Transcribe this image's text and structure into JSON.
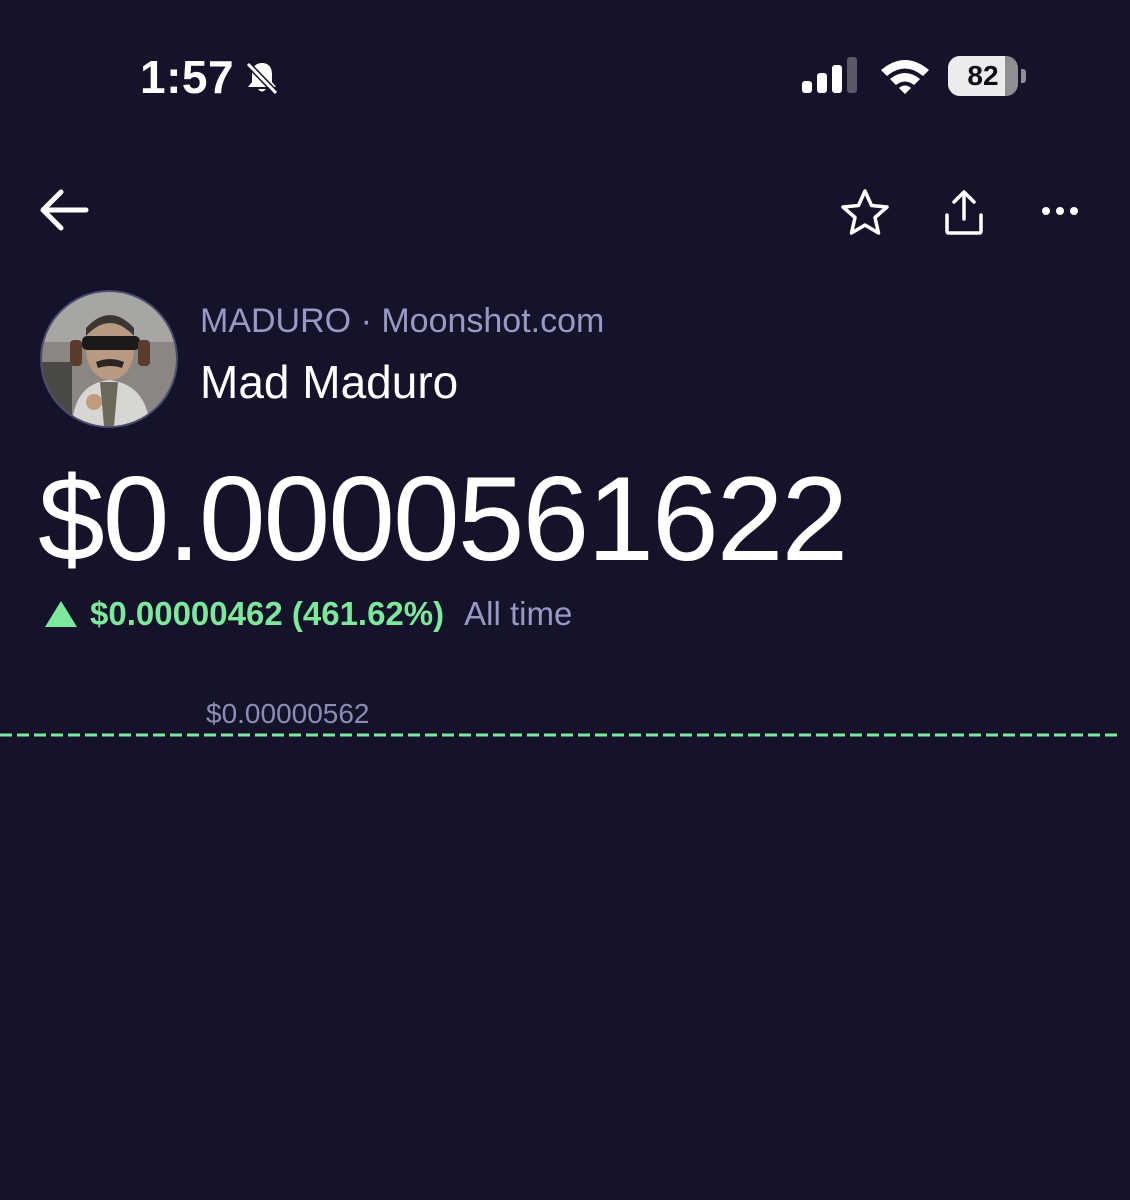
{
  "status_bar": {
    "time": "1:57",
    "battery_percent": "82",
    "battery_level": 0.82,
    "icons": [
      "bell-slash-icon",
      "cellular-signal-icon",
      "wifi-icon",
      "battery-icon"
    ]
  },
  "nav": {
    "icons": [
      "back-arrow-icon",
      "star-icon",
      "share-icon",
      "more-icon"
    ]
  },
  "token": {
    "ticker": "MADURO",
    "separator": "·",
    "source": "Moonshot.com",
    "name": "Mad Maduro",
    "price": "$0.0000561622",
    "change": "$0.00000462 (461.62%)",
    "period": "All time",
    "avatar": "token-avatar-photo"
  },
  "chart_data": {
    "type": "line",
    "y_label": "$0.00000562",
    "line_style": "dashed",
    "color": "#7de89b"
  },
  "colors": {
    "background": "#14132a",
    "accent_green": "#7de89b",
    "muted_text": "#9a98c4"
  }
}
